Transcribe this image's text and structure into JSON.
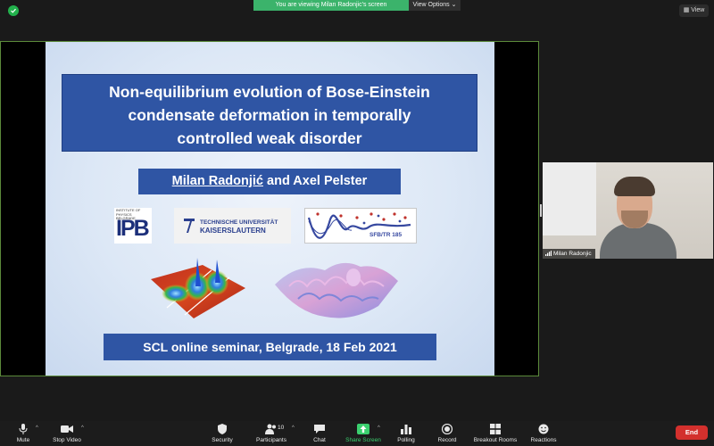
{
  "top": {
    "viewing_banner": "You are viewing Milan Radonjic's screen",
    "view_options": "View Options ⌄",
    "view_button": "View"
  },
  "slide": {
    "title_lines": [
      "Non-equilibrium evolution of Bose-Einstein",
      "condensate deformation in temporally",
      "controlled weak disorder"
    ],
    "author_primary": "Milan Radonjić",
    "author_rest": " and Axel Pelster",
    "ipb_small": "INSTITUTE OF PHYSICS BELGRADE",
    "ipb_big": "IPB",
    "tu_line1": "TECHNISCHE UNIVERSITÄT",
    "tu_line2": "KAISERSLAUTERN",
    "sfb_text": "SFB/TR 185",
    "seminar": "SCL online seminar, Belgrade, 18 Feb 2021"
  },
  "participant": {
    "name": "Milan Radonjic"
  },
  "toolbar": {
    "mute": "Mute",
    "stop_video": "Stop Video",
    "security": "Security",
    "participants": "Participants",
    "participants_count": "10",
    "chat": "Chat",
    "share_screen": "Share Screen",
    "polling": "Polling",
    "record": "Record",
    "breakout_rooms": "Breakout Rooms",
    "reactions": "Reactions",
    "end": "End"
  },
  "colors": {
    "banner_green": "#3bb36b",
    "slide_blue": "#2f55a4",
    "end_red": "#d3302d",
    "share_green": "#3bd06f"
  }
}
